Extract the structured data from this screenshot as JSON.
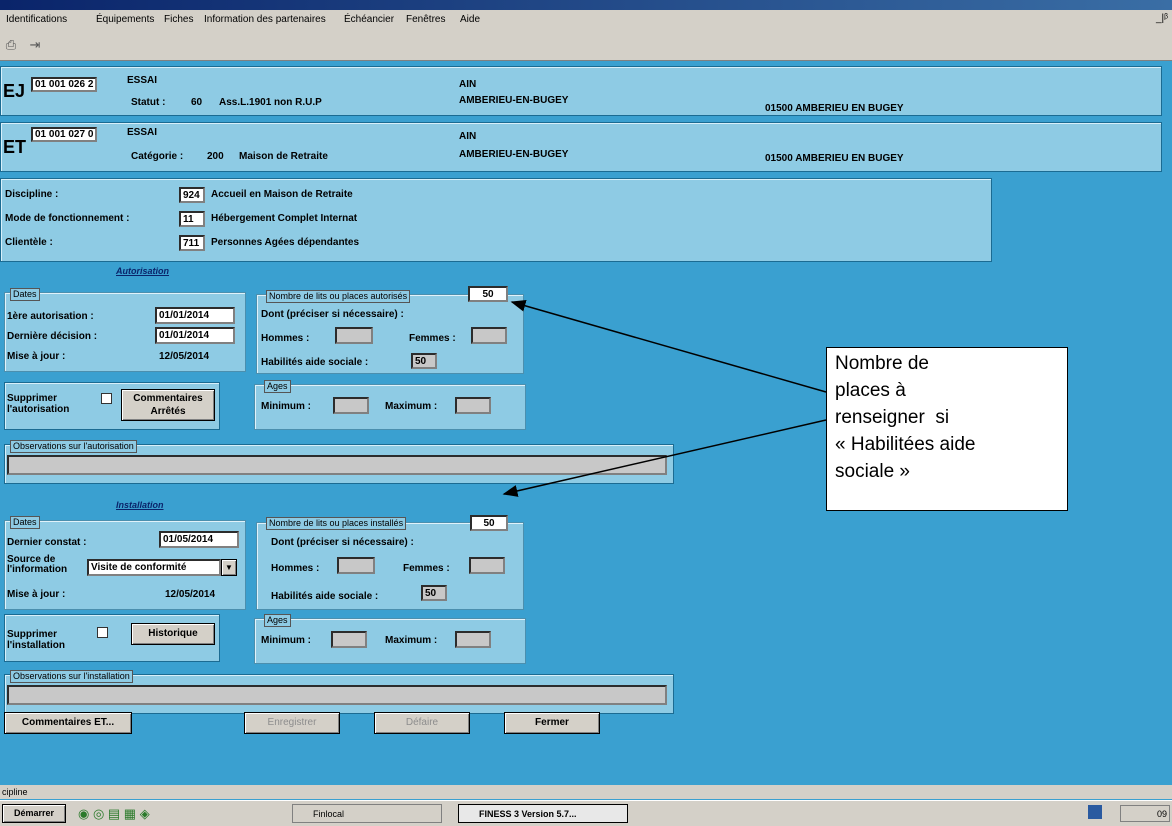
{
  "menu": {
    "items": [
      "Identifications",
      "Équipements",
      "Fiches",
      "Information des partenaires",
      "Échéancier",
      "Fenêtres",
      "Aide"
    ],
    "window_controls": "_|ᵝ"
  },
  "ej": {
    "prefix": "EJ",
    "id": "01 001 026 2",
    "name": "ESSAI",
    "statut_label": "Statut :",
    "statut_code": "60",
    "statut_text": "Ass.L.1901 non R.U.P",
    "dept": "AIN",
    "city": "AMBERIEU-EN-BUGEY",
    "address": "01500 AMBERIEU EN BUGEY"
  },
  "et": {
    "prefix": "ET",
    "id": "01 001 027 0",
    "name": "ESSAI",
    "categorie_label": "Catégorie :",
    "categorie_code": "200",
    "categorie_text": "Maison de Retraite",
    "dept": "AIN",
    "city": "AMBERIEU-EN-BUGEY",
    "address": "01500 AMBERIEU EN BUGEY"
  },
  "discipline": {
    "discipline_label": "Discipline :",
    "discipline_code": "924",
    "discipline_text": "Accueil en Maison de Retraite",
    "mode_label": "Mode de fonctionnement :",
    "mode_code": "11",
    "mode_text": "Hébergement Complet Internat",
    "clientele_label": "Clientèle :",
    "clientele_code": "711",
    "clientele_text": "Personnes Agées dépendantes"
  },
  "autorisation": {
    "title": "Autorisation",
    "dates_legend": "Dates",
    "first_label": "1ère autorisation :",
    "first_value": "01/01/2014",
    "last_label": "Dernière décision :",
    "last_value": "01/01/2014",
    "maj_label": "Mise à jour :",
    "maj_value": "12/05/2014",
    "lits_legend": "Nombre de lits ou places autorisés",
    "lits_value": "50",
    "dont_label": "Dont (préciser si nécessaire) :",
    "hommes_label": "Hommes :",
    "femmes_label": "Femmes :",
    "aide_label": "Habilités aide sociale :",
    "aide_value": "50",
    "supprimer_label": "Supprimer l'autorisation",
    "commentaires_button": "Commentaires Arrêtés",
    "ages_legend": "Ages",
    "min_label": "Minimum :",
    "max_label": "Maximum :",
    "obs_legend": "Observations sur l'autorisation"
  },
  "installation": {
    "title": "Installation",
    "dates_legend": "Dates",
    "constat_label": "Dernier constat :",
    "constat_value": "01/05/2014",
    "source_label": "Source de l'information",
    "source_value": "Visite de conformité",
    "maj_label": "Mise à jour :",
    "maj_value": "12/05/2014",
    "lits_legend": "Nombre de lits ou places installés",
    "lits_value": "50",
    "dont_label": "Dont (préciser si nécessaire) :",
    "hommes_label": "Hommes :",
    "femmes_label": "Femmes :",
    "aide_label": "Habilités aide sociale :",
    "aide_value": "50",
    "supprimer_label": "Supprimer l'installation",
    "historique_button": "Historique",
    "ages_legend": "Ages",
    "min_label": "Minimum :",
    "max_label": "Maximum :",
    "obs_legend": "Observations sur l'installation"
  },
  "buttons": {
    "commentaires_et": "Commentaires ET...",
    "enregistrer": "Enregistrer",
    "defaire": "Défaire",
    "fermer": "Fermer"
  },
  "annotation": {
    "line1": "Nombre de",
    "line2": "places à",
    "line3": "renseigner  si",
    "line4": "« Habilitées aide",
    "line5": "sociale »"
  },
  "statusbar": {
    "text": "cipline"
  },
  "taskbar": {
    "start": "Démarrer",
    "task1": "Finlocal",
    "task2": "FINESS 3  Version 5.7...",
    "clock": "09"
  },
  "colors": {
    "background": "#3aa0d0",
    "panel": "#8ecbe4",
    "grey": "#d4d0c8"
  }
}
